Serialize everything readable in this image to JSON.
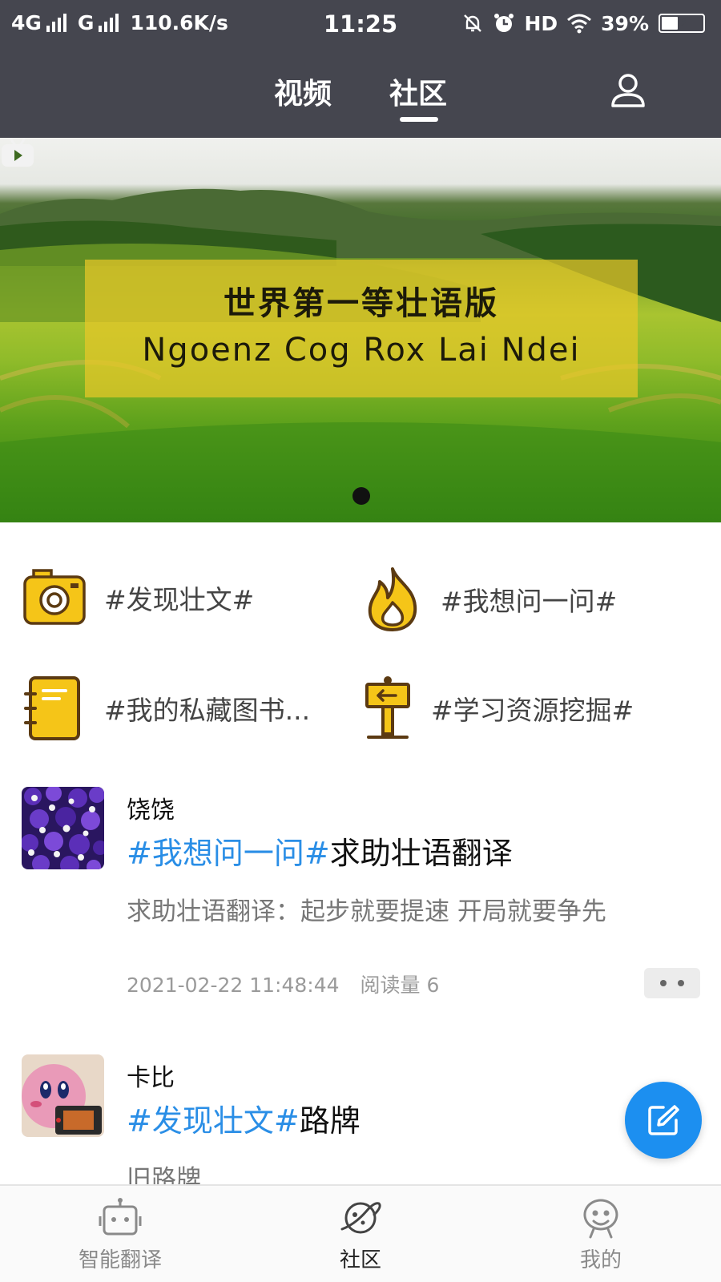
{
  "status_bar": {
    "network1": "4G",
    "network2": "G",
    "speed": "110.6K/s",
    "time": "11:25",
    "hd": "HD",
    "battery_text": "39%",
    "battery_level": 0.39
  },
  "top_nav": {
    "tabs": [
      {
        "label": "视频",
        "active": false
      },
      {
        "label": "社区",
        "active": true
      }
    ]
  },
  "banner": {
    "title_zh": "世界第一等壮语版",
    "title_en": "Ngoenz Cog Rox Lai Ndei"
  },
  "categories": [
    {
      "label": "#发现壮文#",
      "icon": "camera-icon"
    },
    {
      "label": "#我想问一问#",
      "icon": "flame-icon"
    },
    {
      "label": "#我的私藏图书...",
      "icon": "notebook-icon"
    },
    {
      "label": "#学习资源挖掘#",
      "icon": "signpost-icon"
    }
  ],
  "posts": [
    {
      "author": "饶饶",
      "tag": "#我想问一问#",
      "title": "求助壮语翻译",
      "excerpt": "求助壮语翻译：起步就要提速 开局就要争先",
      "datetime": "2021-02-22 11:48:44",
      "reads": "阅读量 6"
    },
    {
      "author": "卡比",
      "tag": "#发现壮文#",
      "title": "路牌",
      "excerpt": "旧路牌"
    }
  ],
  "bottom_nav": [
    {
      "label": "智能翻译",
      "icon": "robot-icon",
      "active": false
    },
    {
      "label": "社区",
      "icon": "planet-icon",
      "active": true
    },
    {
      "label": "我的",
      "icon": "smiley-icon",
      "active": false
    }
  ],
  "colors": {
    "header_bg": "#45464f",
    "tag_blue": "#2a8ee6",
    "fab_blue": "#1c8ff0",
    "icon_yellow": "#f5c518",
    "icon_brown": "#5b3a12"
  }
}
